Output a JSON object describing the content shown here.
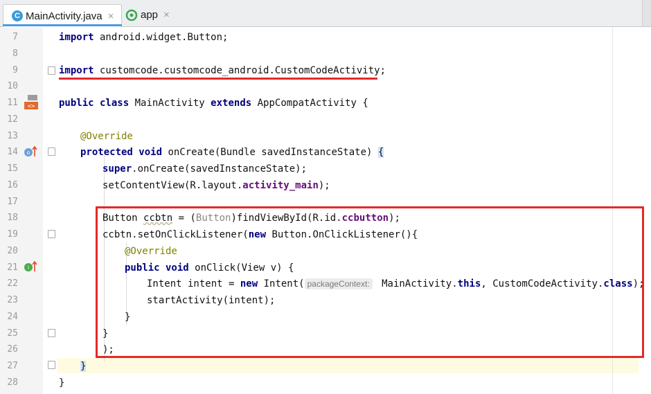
{
  "tabs": [
    {
      "label": "MainActivity.java",
      "icon": "class-c-icon",
      "close": "×"
    },
    {
      "label": "app",
      "icon": "android-module-icon",
      "close": "×"
    }
  ],
  "line_numbers": [
    "7",
    "8",
    "9",
    "10",
    "11",
    "12",
    "13",
    "14",
    "15",
    "16",
    "17",
    "18",
    "19",
    "20",
    "21",
    "22",
    "23",
    "24",
    "25",
    "26",
    "27",
    "28"
  ],
  "code": {
    "l7": {
      "kw": "import",
      "rest": " android.widget.Button;"
    },
    "l9": {
      "kw": "import",
      "rest": " customcode.customcode_android.CustomCodeActivity;"
    },
    "l11": {
      "kw1": "public class",
      "mid": " MainActivity ",
      "kw2": "extends",
      "rest": " AppCompatActivity {"
    },
    "l13": {
      "ann": "@Override"
    },
    "l14": {
      "kw": "protected void",
      "rest": " onCreate(Bundle savedInstanceState) ",
      "brace": "{"
    },
    "l15": {
      "kw": "super",
      "rest": ".onCreate(savedInstanceState);"
    },
    "l16": {
      "a": "setContentView(R.layout.",
      "field": "activity_main",
      "b": ");"
    },
    "l18": {
      "a": "Button ",
      "var": "ccbtn",
      "b": " = (",
      "cast": "Button",
      "c": ")findViewById(R.id.",
      "field": "ccbutton",
      "d": ");"
    },
    "l19": {
      "a": "ccbtn.setOnClickListener(",
      "kw": "new",
      "b": " Button.OnClickListener(){"
    },
    "l20": {
      "ann": "@Override"
    },
    "l21": {
      "kw": "public void",
      "rest": " onClick(View v) {"
    },
    "l22": {
      "a": "Intent intent = ",
      "kw": "new",
      "b": " Intent(",
      "hint": "packageContext:",
      "c": " MainActivity.",
      "kw2": "this",
      "d": ", CustomCodeActivity.",
      "kw3": "class",
      "e": ");"
    },
    "l23": {
      "a": "startActivity(intent);"
    },
    "l24": {
      "a": "}"
    },
    "l25": {
      "a": "}"
    },
    "l26": {
      "a": ");"
    },
    "l27": {
      "a": "}"
    },
    "l28": {
      "a": "}"
    }
  },
  "colors": {
    "highlight": "#e32a2a",
    "keyword": "#000080",
    "annotation": "#808000",
    "field": "#660e7a"
  }
}
